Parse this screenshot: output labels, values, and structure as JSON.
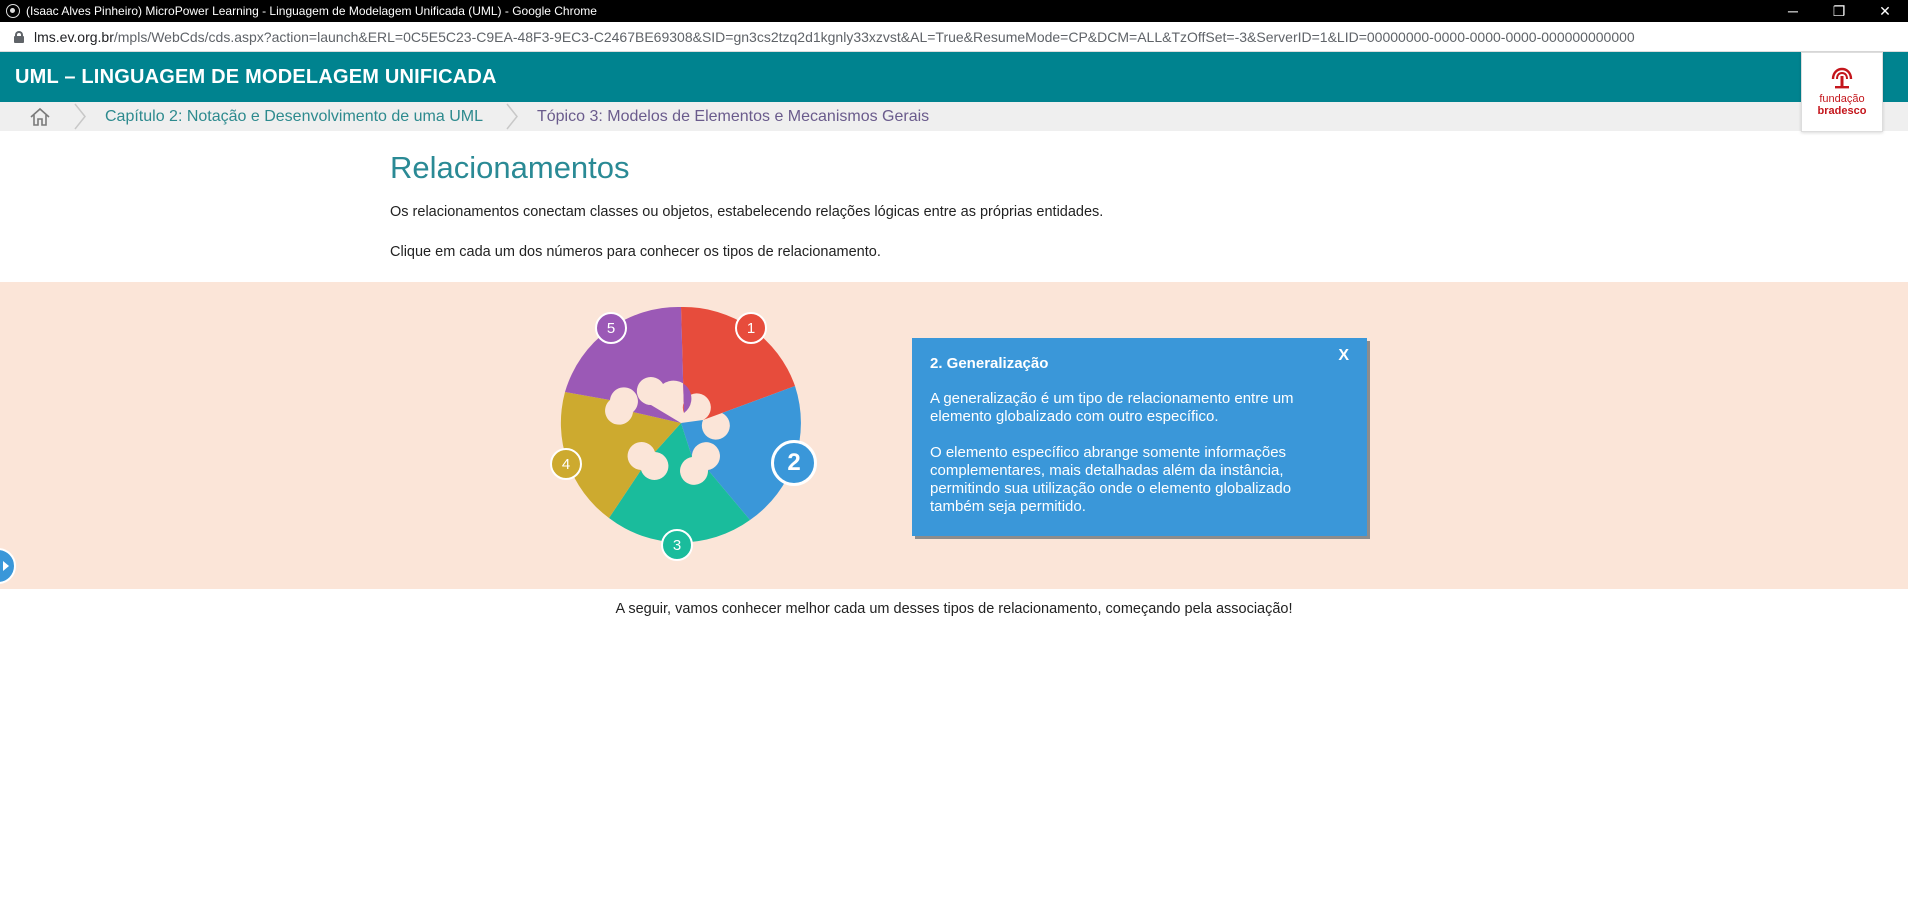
{
  "browser": {
    "window_title": "(Isaac Alves Pinheiro) MicroPower Learning - Linguagem de Modelagem Unificada (UML) - Google Chrome",
    "url_host": "lms.ev.org.br",
    "url_path": "/mpls/WebCds/cds.aspx?action=launch&ERL=0C5E5C23-C9EA-48F3-9EC3-C2467BE69308&SID=gn3cs2tzq2d1kgnly33xzvst&AL=True&ResumeMode=CP&DCM=ALL&TzOffSet=-3&ServerID=1&LID=00000000-0000-0000-0000-000000000000",
    "controls": {
      "minimize": "─",
      "restore": "❐",
      "close": "✕"
    }
  },
  "header": {
    "course_title": "UML – LINGUAGEM DE MODELAGEM UNIFICADA",
    "logo_line1": "fundação",
    "logo_line2": "bradesco"
  },
  "breadcrumb": {
    "items": [
      {
        "label": "Capítulo 2: Notação e Desenvolvimento de uma UML"
      },
      {
        "label": "Tópico 3: Modelos de Elementos e Mecanismos Gerais"
      }
    ]
  },
  "content": {
    "heading": "Relacionamentos",
    "intro": "Os relacionamentos conectam classes ou objetos, estabelecendo relações lógicas entre as próprias entidades.",
    "instruction": "Clique em cada um dos números para conhecer os tipos de relacionamento.",
    "footer": "A seguir, vamos conhecer melhor cada um desses tipos de relacionamento, começando pela associação!"
  },
  "puzzle": {
    "pieces": [
      {
        "number": "1",
        "color": "#e74c3c"
      },
      {
        "number": "2",
        "color": "#3a97d9",
        "active": true
      },
      {
        "number": "3",
        "color": "#1abc9c"
      },
      {
        "number": "4",
        "color": "#cdaa2f"
      },
      {
        "number": "5",
        "color": "#9b59b6"
      }
    ]
  },
  "popup": {
    "title": "2. Generalização",
    "paragraph1": "A generalização é um tipo de relacionamento entre um elemento globalizado com outro específico.",
    "paragraph2": "O elemento específico abrange somente informações complementares, mais detalhadas além da instância, permitindo sua utilização onde o elemento globalizado também seja permitido.",
    "close": "X"
  },
  "colors": {
    "header": "#00838f",
    "band": "#fbe5d8",
    "popup": "#3a97d9",
    "heading": "#2a8a95"
  }
}
